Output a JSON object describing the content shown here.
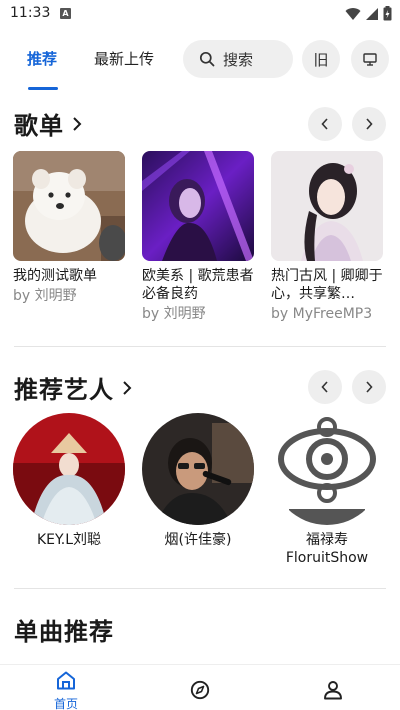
{
  "status": {
    "time": "11:33",
    "notification_icon": "A"
  },
  "tabs": [
    {
      "label": "推荐",
      "active": true
    },
    {
      "label": "最新上传",
      "active": false
    }
  ],
  "search": {
    "label": "搜索"
  },
  "header_buttons": {
    "old_label": "旧",
    "screen_icon": "monitor-icon"
  },
  "sections": {
    "playlists": {
      "title": "歌单"
    },
    "artists": {
      "title": "推荐艺人"
    },
    "songs": {
      "title": "单曲推荐"
    }
  },
  "playlists": [
    {
      "title": "我的测试歌单",
      "author": "by 刘明野"
    },
    {
      "title": "欧美系 | 歌荒患者必备良药",
      "author": "by 刘明野"
    },
    {
      "title": "热门古风 | 卿卿于心，共享繁…",
      "author": "by MyFreeMP3"
    }
  ],
  "artists": [
    {
      "name": "KEY.L刘聪"
    },
    {
      "name": "烟(许佳豪)"
    },
    {
      "name": "福禄寿FloruitShow"
    }
  ],
  "bottom_nav": [
    {
      "label": "首页",
      "icon": "home-icon",
      "active": true
    },
    {
      "label": "",
      "icon": "compass-icon",
      "active": false
    },
    {
      "label": "",
      "icon": "profile-icon",
      "active": false
    }
  ],
  "colors": {
    "accent": "#1565d8",
    "pill_bg": "#efefef",
    "muted_text": "#888888"
  }
}
